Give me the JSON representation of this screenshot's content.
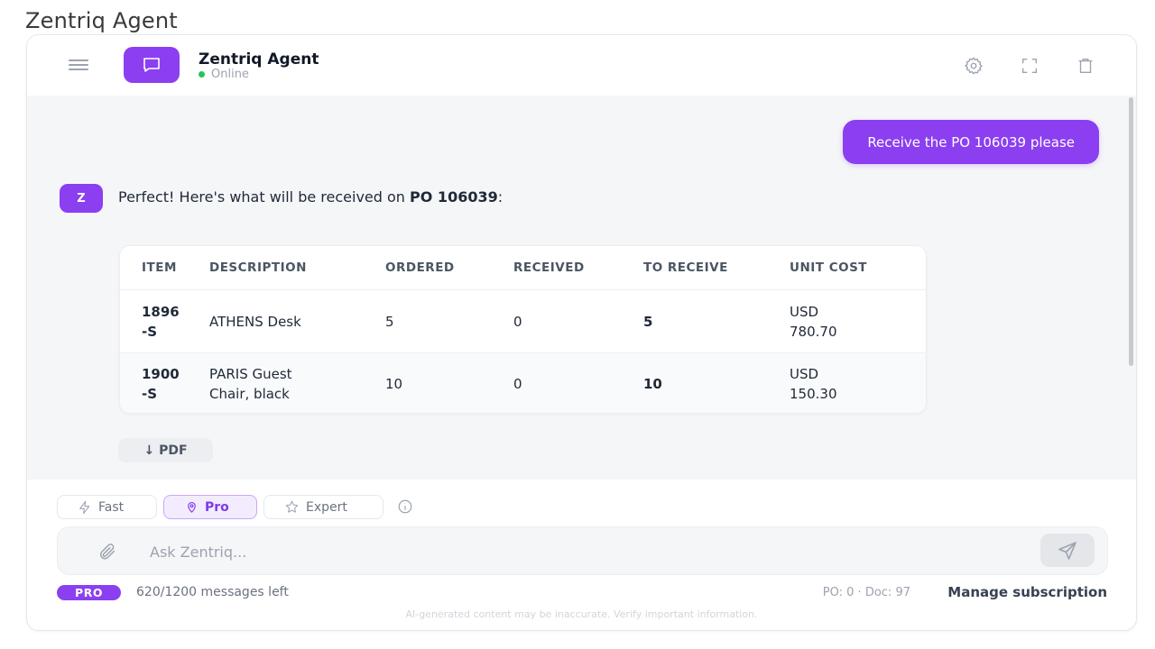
{
  "page_title": "Zentriq Agent",
  "header": {
    "agent_name": "Zentriq Agent",
    "status": "Online",
    "icons": [
      "menu-icon",
      "chat-bubble-icon",
      "gear-icon",
      "expand-icon",
      "trash-icon"
    ]
  },
  "chat": {
    "user_message": "Receive the PO 106039 please",
    "bot_avatar": "Z",
    "bot_intro": "Perfect! Here's what will be received on ",
    "bot_po": "PO 106039",
    "bot_suffix": ":",
    "table": {
      "headers": [
        "ITEM",
        "DESCRIPTION",
        "ORDERED",
        "RECEIVED",
        "TO RECEIVE",
        "UNIT COST"
      ],
      "rows": [
        {
          "item_l1": "1896",
          "item_l2": "-S",
          "desc": "ATHENS Desk",
          "ordered": "5",
          "received": "0",
          "to_receive": "5",
          "cost_l1": "USD",
          "cost_l2": "780.70"
        },
        {
          "item_l1": "1900",
          "item_l2": "-S",
          "desc_l1": "PARIS Guest",
          "desc_l2": "Chair, black",
          "ordered": "10",
          "received": "0",
          "to_receive": "10",
          "cost_l1": "USD",
          "cost_l2": "150.30"
        }
      ]
    },
    "pdf_label": "↓ PDF"
  },
  "composer": {
    "modes": [
      {
        "label": "Fast",
        "active": false
      },
      {
        "label": "Pro",
        "active": true
      },
      {
        "label": "Expert",
        "active": false
      }
    ],
    "placeholder": "Ask Zentriq...",
    "badge": "PRO",
    "messages_left": "620/1200 messages left",
    "po_doc": "PO: 0 · Doc: 97",
    "manage": "Manage subscription",
    "disclaimer": "AI-generated content may be inaccurate. Verify important information."
  },
  "colors": {
    "accent": "#8b3ff0",
    "online": "#22c55e",
    "chat_bg": "#f5f6f8"
  }
}
